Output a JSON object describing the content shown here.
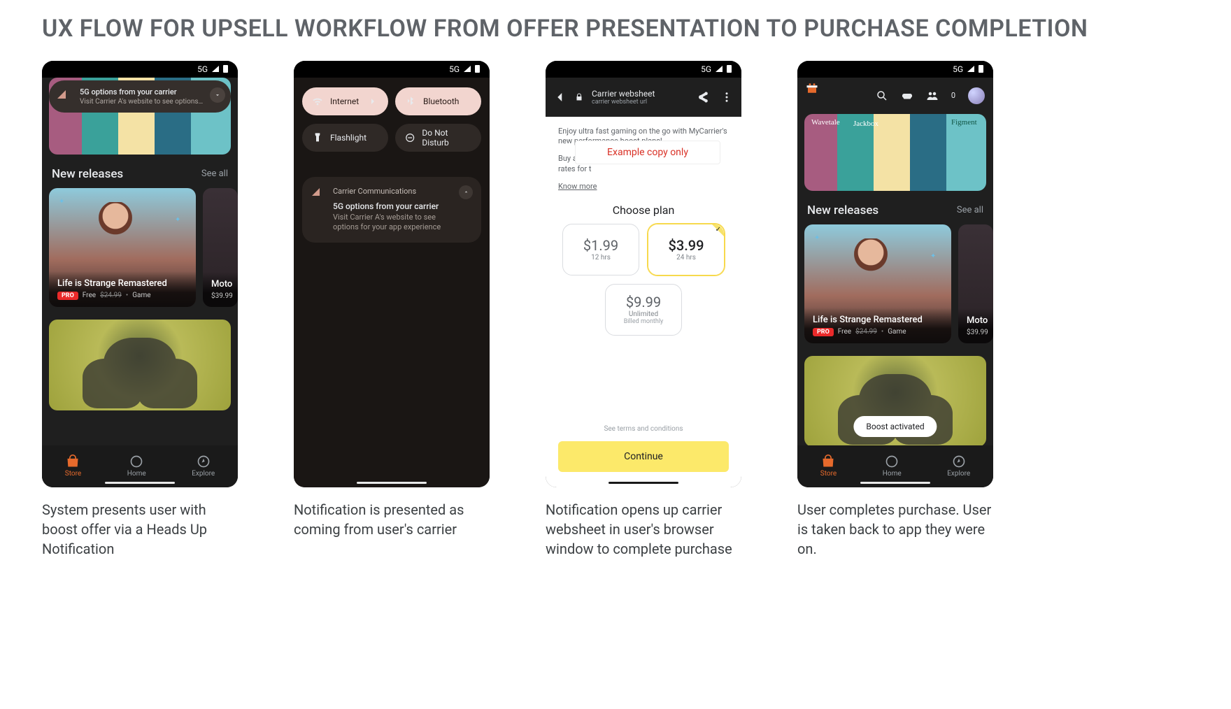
{
  "page": {
    "title": "UX FLOW FOR UPSELL WORKFLOW FROM OFFER PRESENTATION TO PURCHASE COMPLETION"
  },
  "status": {
    "network": "5G"
  },
  "captions": {
    "s1": "System presents user with boost offer via a Heads Up Notification",
    "s2": "Notification is presented as coming from user's carrier",
    "s3": "Notification opens up carrier websheet in user's browser window to complete purchase",
    "s4": "User completes purchase. User is taken back to app they were on."
  },
  "store": {
    "section_title": "New releases",
    "see_all": "See all",
    "hero_tiles": [
      "Wavetale",
      "Jackbox",
      "Figment"
    ],
    "card1": {
      "title": "Life is Strange Remastered",
      "pro": "PRO",
      "free": "Free",
      "strike_price": "$24.99",
      "category": "Game"
    },
    "card2": {
      "title_prefix": "Moto",
      "price": "$39.99"
    },
    "nav": {
      "store": "Store",
      "home": "Home",
      "explore": "Explore"
    }
  },
  "hun": {
    "title": "5G options from your carrier",
    "subtitle": "Visit Carrier A's website to see options…"
  },
  "qs": {
    "internet": "Internet",
    "bluetooth": "Bluetooth",
    "flashlight": "Flashlight",
    "dnd": "Do Not Disturb"
  },
  "notif": {
    "source": "Carrier Communications",
    "title": "5G options from your carrier",
    "body": "Visit Carrier A's website to see options for your app experience"
  },
  "websheet": {
    "bar_title": "Carrier websheet",
    "bar_url": "carrier websheet url",
    "p1": "Enjoy ultra fast gaming on the go with MyCarrier's new performance boost plans!",
    "p2a": "Buy a pas",
    "p2b": "plan to enjoy u",
    "p2c": "rates for t",
    "know_more": "Know more",
    "example_label": "Example copy only",
    "choose": "Choose plan",
    "plans": [
      {
        "price": "$1.99",
        "duration": "12 hrs",
        "selected": false
      },
      {
        "price": "$3.99",
        "duration": "24 hrs",
        "selected": true
      },
      {
        "price": "$9.99",
        "duration": "Unlimited",
        "sub": "Billed monthly",
        "selected": false
      }
    ],
    "terms": "See terms and conditions",
    "continue": "Continue"
  },
  "boost": {
    "label": "Boost activated"
  }
}
